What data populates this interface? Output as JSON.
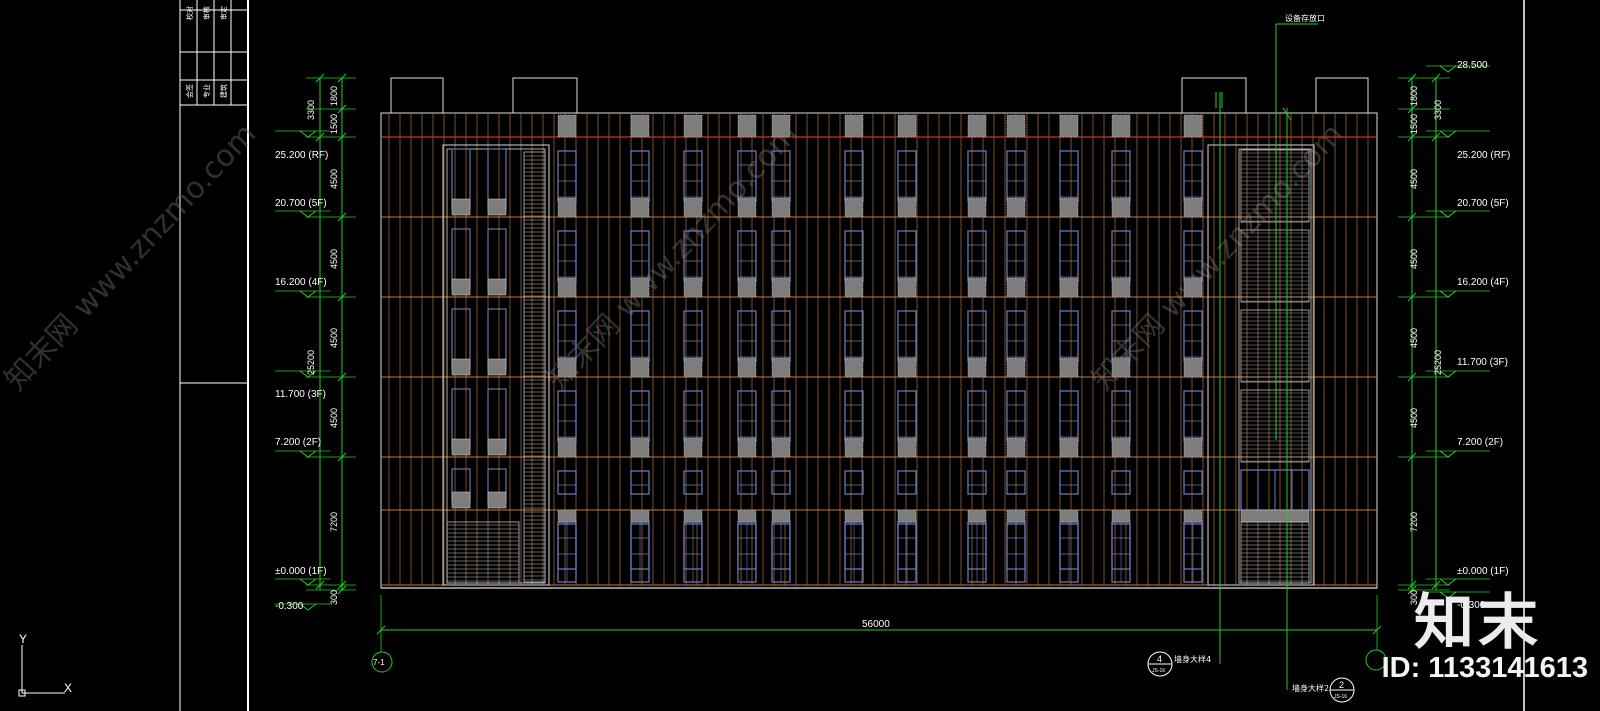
{
  "title_block": {
    "cells": [
      "校对",
      "审核",
      "审定"
    ],
    "cells_lower": [
      "会签",
      "专业",
      "建筑"
    ]
  },
  "ucs": {
    "y_label": "Y",
    "x_label": "X"
  },
  "levels_left": [
    {
      "key": "rf",
      "label": "25.200 (RF)"
    },
    {
      "key": "5f",
      "label": "20.700 (5F)"
    },
    {
      "key": "4f",
      "label": "16.200 (4F)"
    },
    {
      "key": "3f",
      "label": "11.700 (3F)"
    },
    {
      "key": "2f",
      "label": "7.200 (2F)"
    },
    {
      "key": "1f",
      "label": "±0.000 (1F)"
    },
    {
      "key": "gr",
      "label": "-0.300"
    }
  ],
  "levels_right": [
    {
      "key": "top",
      "label": "28.500"
    },
    {
      "key": "rf",
      "label": "25.200 (RF)"
    },
    {
      "key": "5f",
      "label": "20.700 (5F)"
    },
    {
      "key": "4f",
      "label": "16.200 (4F)"
    },
    {
      "key": "3f",
      "label": "11.700 (3F)"
    },
    {
      "key": "2f",
      "label": "7.200 (2F)"
    },
    {
      "key": "1f",
      "label": "±0.000 (1F)"
    },
    {
      "key": "gr",
      "label": "-0.300"
    }
  ],
  "dims_inner": [
    "1800",
    "1500",
    "4500",
    "4500",
    "4500",
    "4500",
    "7200",
    "300"
  ],
  "dims_outer": [
    "3300",
    "25200"
  ],
  "overall_dim": "56000",
  "axis_left": "7-1",
  "callouts": {
    "top_note": "设备存放口",
    "detail4_label": "墙身大样4",
    "detail4_num": "4",
    "detail4_ref": "JS-16",
    "detail2_label": "墙身大样2",
    "detail2_num": "2",
    "detail2_ref": "JS-16"
  },
  "watermark": {
    "text": "知末网 www.znzmo.com",
    "brand": "知末",
    "id_label": "ID: 1133141613"
  },
  "colors": {
    "background": "#000000",
    "frame": "#ffffff",
    "dimension": "#20d020",
    "floor_line_red": "#d03020",
    "floor_line_orange": "#c8783a",
    "fin": "#b07040",
    "window": "#6a80c0",
    "louver": "#bfbfbf"
  }
}
